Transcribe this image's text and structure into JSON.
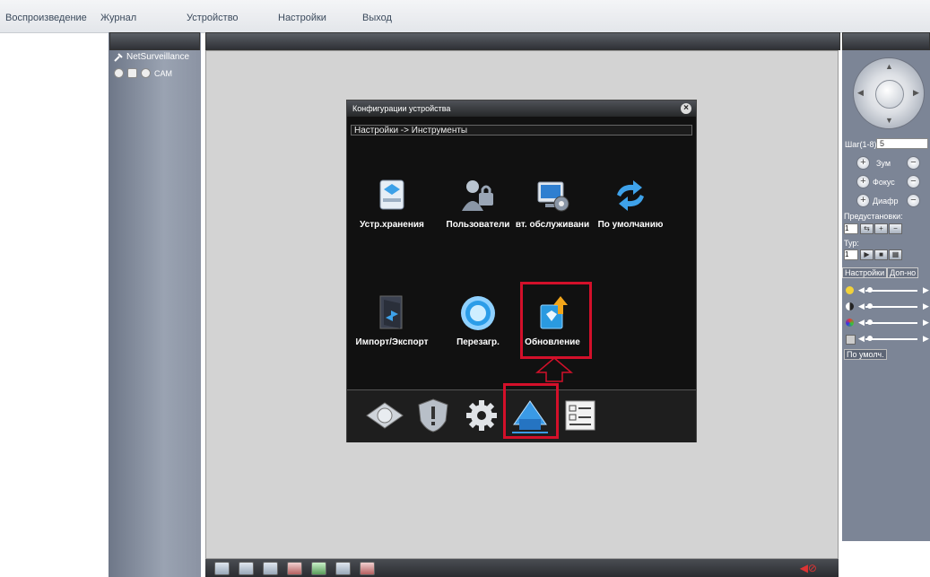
{
  "menu": {
    "items": [
      "Воспроизведение",
      "Журнал",
      "Устройство",
      "Настройки",
      "Выход"
    ]
  },
  "device_tree": {
    "device_name": "NetSurveillance",
    "channel_label": "CAM"
  },
  "ptz": {
    "step_label": "Шаг(1-8):",
    "step_value": "5",
    "zoom_label": "Зум",
    "focus_label": "Фокус",
    "iris_label": "Диафр",
    "preset_label": "Предустановки:",
    "preset_value": "1",
    "tour_label": "Тур:",
    "tour_value": "1"
  },
  "image_settings": {
    "tabs": [
      "Настройки",
      "Доп-но"
    ],
    "default_button": "По умолч."
  },
  "dialog": {
    "title": "Конфигурации устройства",
    "path": "Настройки -> Инструменты",
    "tools": [
      {
        "label": "Устр.хранения",
        "icon": "storage-icon"
      },
      {
        "label": "Пользователи",
        "icon": "users-icon"
      },
      {
        "label": "вт. обслуживани",
        "icon": "maintenance-icon"
      },
      {
        "label": "По умолчанию",
        "icon": "default-reset-icon"
      },
      {
        "label": "Импорт/Экспорт",
        "icon": "import-export-icon"
      },
      {
        "label": "Перезагр.",
        "icon": "reboot-icon"
      },
      {
        "label": "Обновление",
        "icon": "upgrade-icon"
      }
    ],
    "categories": [
      "record-category-icon",
      "alarm-category-icon",
      "system-category-icon",
      "tools-category-icon",
      "info-category-icon"
    ],
    "highlighted": "Обновление",
    "highlight_color": "#d3102a"
  },
  "colors": {
    "video_bg": "#d3d3d3",
    "panel_bg": "#7c8596",
    "dialog_bg": "#111111"
  }
}
